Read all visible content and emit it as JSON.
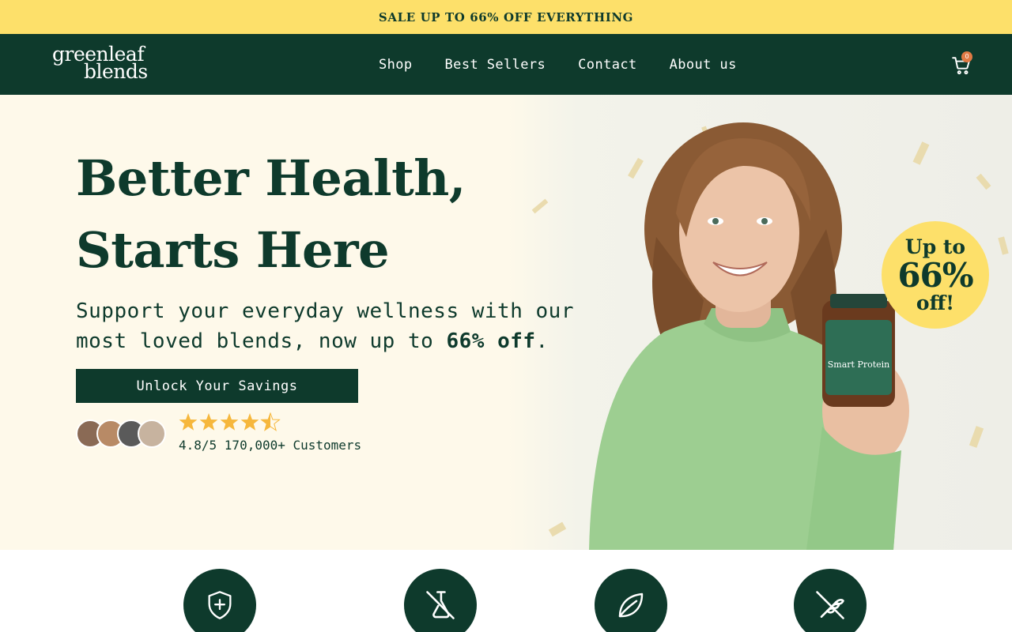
{
  "announcement": {
    "text": "SALE UP TO 66% OFF EVERYTHING"
  },
  "brand": {
    "logo_line1": "greenleaf",
    "logo_line2": "blends"
  },
  "nav": {
    "links": [
      {
        "label": "Shop"
      },
      {
        "label": "Best Sellers"
      },
      {
        "label": "Contact"
      },
      {
        "label": "About us"
      }
    ],
    "cart_count": "0"
  },
  "hero": {
    "title_line1": "Better Health,",
    "title_line2": "Starts Here",
    "subtitle_prefix": "Support your everyday wellness with our most loved blends, now up to ",
    "subtitle_bold": "66% off",
    "subtitle_suffix": ".",
    "cta_label": "Unlock Your Savings",
    "rating_value": 4.5,
    "rating_text": "4.8/5 170,000+ Customers",
    "product_label": "Smart Protein",
    "promo_badge": {
      "line1": "Up to",
      "line2": "66%",
      "line3": "off!"
    }
  },
  "colors": {
    "brand_green": "#0e3a2c",
    "announcement_yellow": "#fde06a",
    "hero_cream": "#fef9ea",
    "star_gold": "#f6b73c",
    "cart_badge": "#e07a44"
  },
  "features": {
    "icons": [
      "shield-plus-icon",
      "no-lab-flask-icon",
      "leaf-icon",
      "no-gluten-icon"
    ]
  }
}
